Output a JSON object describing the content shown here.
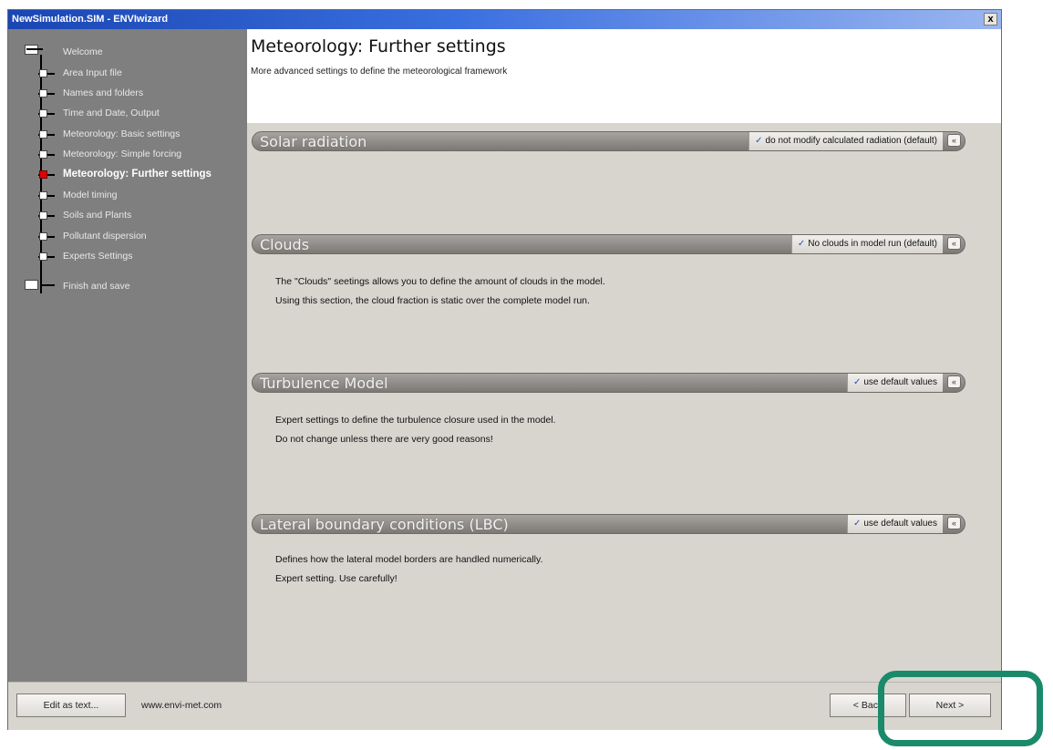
{
  "window": {
    "title": "NewSimulation.SIM - ENVIwizard",
    "close_label": "x"
  },
  "sidebar": {
    "items": [
      {
        "label": "Welcome",
        "state": "root"
      },
      {
        "label": "Area Input file",
        "state": "normal"
      },
      {
        "label": "Names and folders",
        "state": "normal"
      },
      {
        "label": "Time and Date, Output",
        "state": "normal"
      },
      {
        "label": "Meteorology: Basic settings",
        "state": "normal"
      },
      {
        "label": "Meteorology: Simple forcing",
        "state": "normal"
      },
      {
        "label": "Meteorology: Further settings",
        "state": "active"
      },
      {
        "label": "Model timing",
        "state": "normal"
      },
      {
        "label": "Soils and Plants",
        "state": "normal"
      },
      {
        "label": "Pollutant dispersion",
        "state": "normal"
      },
      {
        "label": "Experts Settings",
        "state": "normal"
      },
      {
        "label": "Finish and save",
        "state": "root"
      }
    ]
  },
  "header": {
    "title": "Meteorology: Further settings",
    "subtitle": "More advanced settings to define the meteorological framework"
  },
  "sections": [
    {
      "title": "Solar radiation",
      "option_check": "✓",
      "option_label": "do not modify calculated radiation (default)",
      "expand_icon": "«",
      "lines": []
    },
    {
      "title": "Clouds",
      "option_check": "✓",
      "option_label": "No clouds in model run (default)",
      "expand_icon": "«",
      "lines": [
        "The \"Clouds\" seetings allows you to define the amount of clouds in the model.",
        "Using this section, the cloud fraction is static over the complete model run."
      ]
    },
    {
      "title": "Turbulence Model",
      "option_check": "✓",
      "option_label": "use default values",
      "expand_icon": "«",
      "lines": [
        "Expert settings to define the turbulence closure used in the model.",
        "Do not change unless there are very good reasons!"
      ]
    },
    {
      "title": "Lateral boundary conditions (LBC)",
      "option_check": "✓",
      "option_label": "use default values",
      "expand_icon": "«",
      "lines": [
        "Defines how the lateral model borders are handled numerically.",
        "Expert setting. Use carefully!"
      ]
    }
  ],
  "footer": {
    "edit_as_text": "Edit as text...",
    "url": "www.envi-met.com",
    "back_label": "< Back",
    "next_label": "Next >"
  },
  "colors": {
    "highlight_ring": "#1a8a6a",
    "active_node": "#e10000"
  }
}
